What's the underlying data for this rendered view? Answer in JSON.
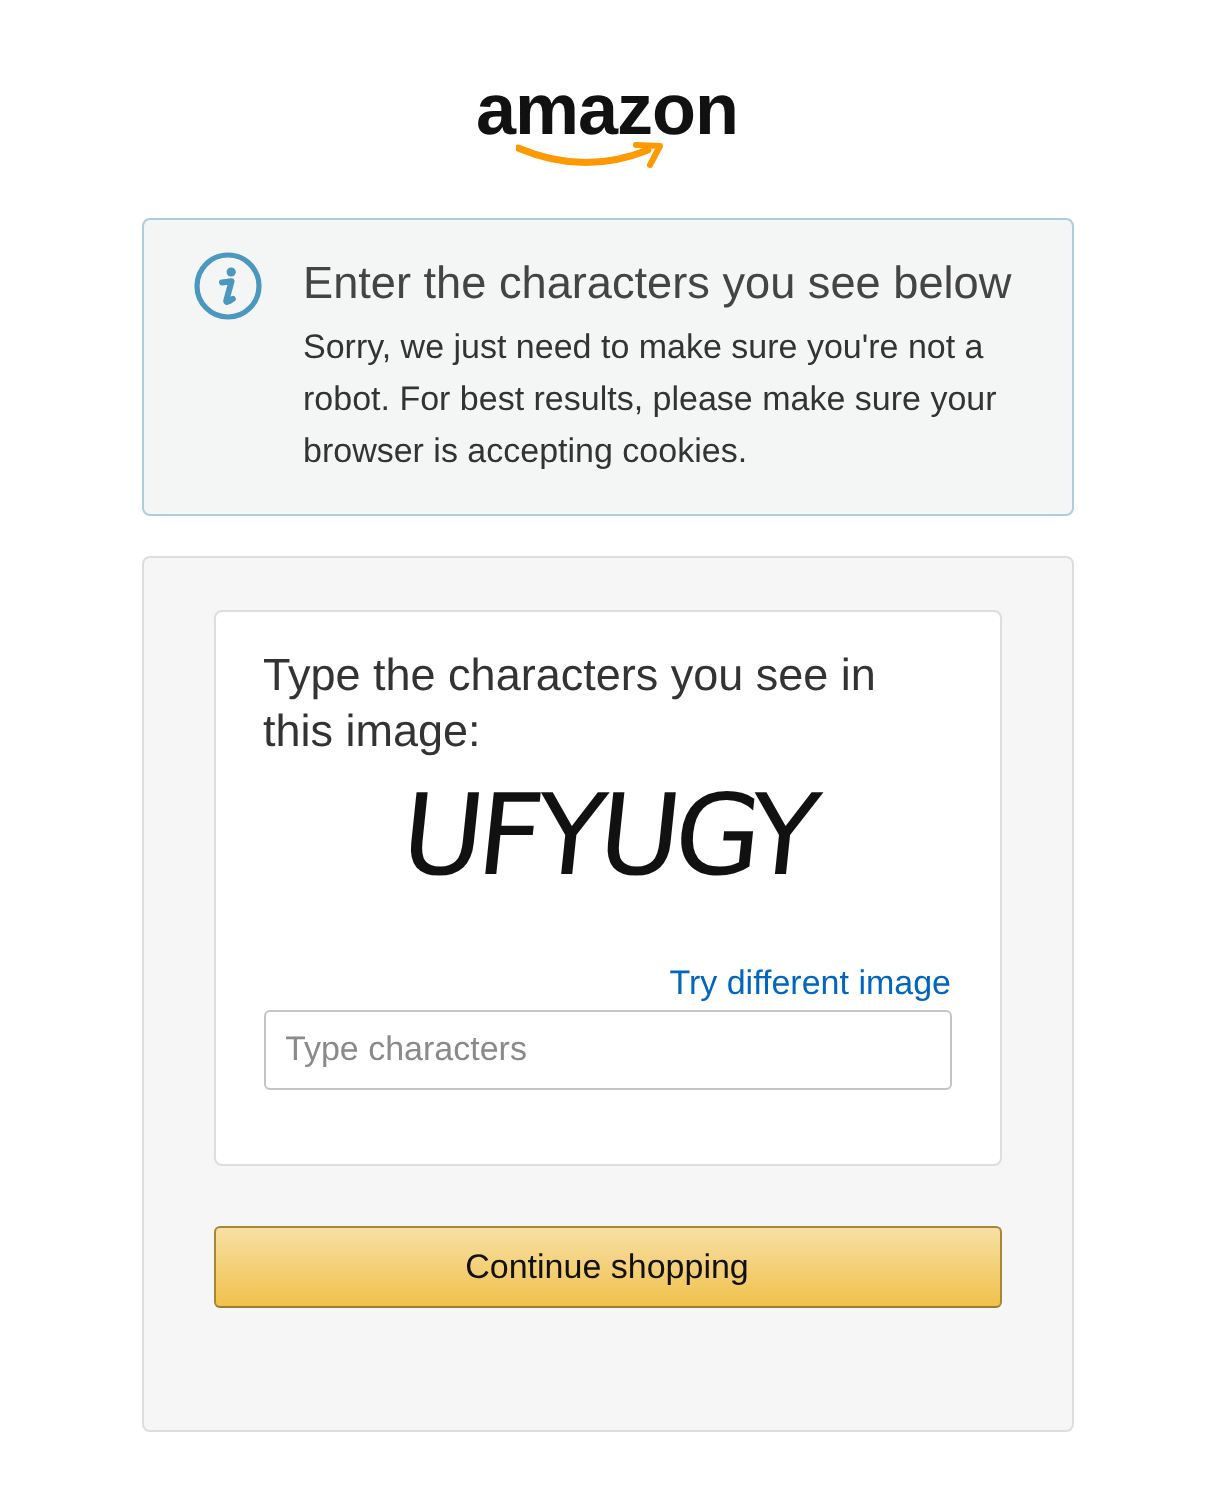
{
  "logo": {
    "text": "amazon"
  },
  "alert": {
    "heading": "Enter the characters you see below",
    "message": "Sorry, we just need to make sure you're not a robot. For best results, please make sure your browser is accepting cookies."
  },
  "captcha": {
    "prompt": "Type the characters you see in this image:",
    "image_text": "UFYUGY",
    "refresh_link": "Try different image",
    "input": {
      "placeholder": "Type characters"
    }
  },
  "button": {
    "label": "Continue shopping"
  }
}
